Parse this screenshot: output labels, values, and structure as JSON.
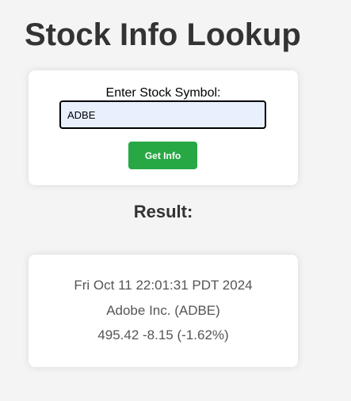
{
  "page": {
    "title": "Stock Info Lookup"
  },
  "form": {
    "label": "Enter Stock Symbol:",
    "input_value": "ADBE",
    "button_label": "Get Info"
  },
  "result": {
    "heading": "Result:",
    "timestamp": "Fri Oct 11 22:01:31 PDT 2024",
    "company": "Adobe Inc. (ADBE)",
    "quote": "495.42 -8.15 (-1.62%)"
  },
  "colors": {
    "button_green": "#28a745",
    "input_autofill_bg": "#e8f0fe",
    "page_bg": "#f4f4f4"
  }
}
